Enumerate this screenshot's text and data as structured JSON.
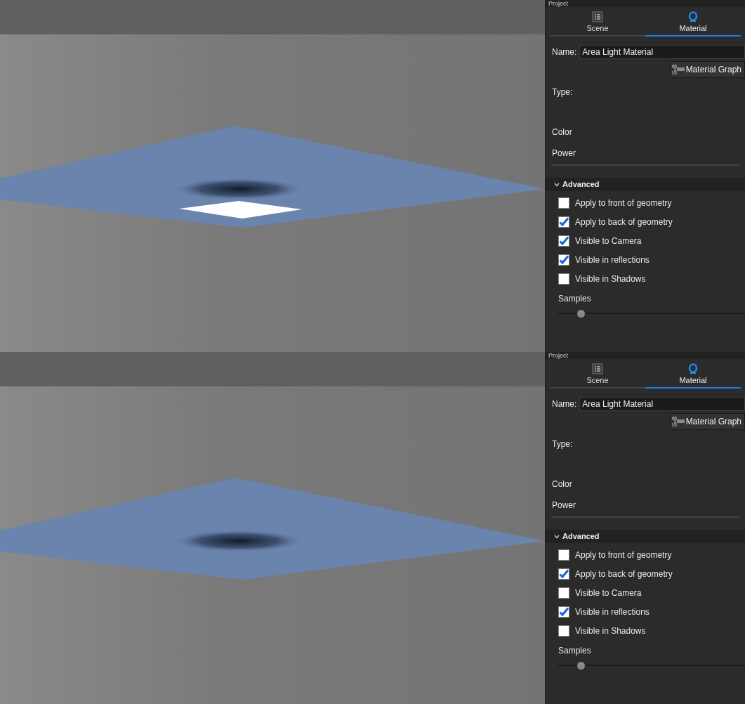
{
  "panels": [
    {
      "render": {
        "light_visible": true
      },
      "header": {
        "title": "Project"
      },
      "tabs": [
        {
          "label": "Scene",
          "kind": "list",
          "selected": false
        },
        {
          "label": "Material",
          "kind": "ring",
          "selected": true
        }
      ],
      "name_field": {
        "label": "Name:",
        "value": "Area Light Material"
      },
      "graph_button": {
        "label": "Material Graph"
      },
      "properties": [
        "Type:",
        "Color",
        "Power"
      ],
      "advanced": {
        "title": "Advanced",
        "expanded": true,
        "options": [
          {
            "label": "Apply to front of geometry",
            "checked": false
          },
          {
            "label": "Apply to back of geometry",
            "checked": true
          },
          {
            "label": "Visible to Camera",
            "checked": true
          },
          {
            "label": "Visible in reflections",
            "checked": true
          },
          {
            "label": "Visible in Shadows",
            "checked": false
          }
        ],
        "samples": {
          "label": "Samples",
          "level": 0.12
        }
      }
    },
    {
      "render": {
        "light_visible": false
      },
      "header": {
        "title": "Project"
      },
      "tabs": [
        {
          "label": "Scene",
          "kind": "list",
          "selected": false
        },
        {
          "label": "Material",
          "kind": "ring",
          "selected": true
        }
      ],
      "name_field": {
        "label": "Name:",
        "value": "Area Light Material"
      },
      "graph_button": {
        "label": "Material Graph"
      },
      "properties": [
        "Type:",
        "Color",
        "Power"
      ],
      "advanced": {
        "title": "Advanced",
        "expanded": true,
        "options": [
          {
            "label": "Apply to front of geometry",
            "checked": false
          },
          {
            "label": "Apply to back of geometry",
            "checked": true
          },
          {
            "label": "Visible to Camera",
            "checked": false
          },
          {
            "label": "Visible in reflections",
            "checked": true
          },
          {
            "label": "Visible in Shadows",
            "checked": false
          }
        ],
        "samples": {
          "label": "Samples",
          "level": 0.12
        }
      }
    }
  ]
}
